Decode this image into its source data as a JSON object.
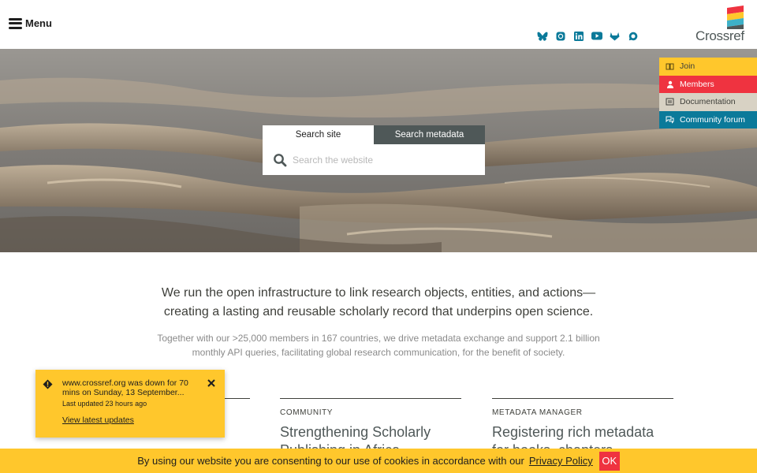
{
  "header": {
    "menu_label": "Menu",
    "logo_text": "Crossref",
    "socials": [
      "bluesky-icon",
      "mastodon-icon",
      "linkedin-icon",
      "youtube-icon",
      "gitlab-icon",
      "discourse-icon"
    ]
  },
  "search": {
    "tabs": [
      {
        "label": "Search site"
      },
      {
        "label": "Search metadata"
      }
    ],
    "placeholder": "Search the website"
  },
  "side_nav": {
    "items": [
      {
        "label": "Join",
        "icon": "book-icon",
        "color": "#ffc72c"
      },
      {
        "label": "Members",
        "icon": "user-icon",
        "color": "#ef3340"
      },
      {
        "label": "Documentation",
        "icon": "docs-icon",
        "color": "#d8d2c4"
      },
      {
        "label": "Community forum",
        "icon": "chat-icon",
        "color": "#0b7a9a"
      }
    ]
  },
  "intro": {
    "lead": "We run the open infrastructure to link research objects, entities, and actions—creating a lasting and reusable scholarly record that underpins open science.",
    "sub": "Together with our >25,000 members in 167 countries, we drive metadata exchange and support 2.1 billion monthly API queries, facilitating global research communication, for the benefit of society."
  },
  "cards": [
    {
      "kicker": "",
      "title": ""
    },
    {
      "kicker": "COMMUNITY",
      "title": "Strengthening Scholarly Publishing in Africa"
    },
    {
      "kicker": "METADATA MANAGER",
      "title": "Registering rich metadata for books, chapters"
    }
  ],
  "alert": {
    "message": "www.crossref.org was down for 70 mins on Sunday, 13 September...",
    "updated": "Last updated 23 hours ago",
    "link": "View latest updates"
  },
  "cookie": {
    "text": "By using our website you are consenting to our use of cookies in accordance with our",
    "link": "Privacy Policy",
    "ok": "OK"
  },
  "colors": {
    "yellow": "#ffc72c",
    "red": "#ef3340",
    "teal": "#0b7a9a",
    "dark": "#3e3f3a"
  }
}
